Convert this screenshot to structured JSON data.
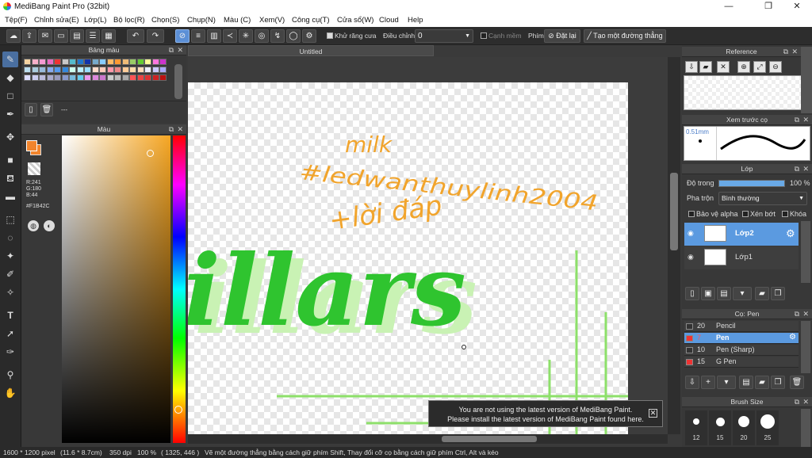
{
  "window": {
    "title": "MediBang Paint Pro (32bit)",
    "minimize": "—",
    "maximize": "❐",
    "close": "✕"
  },
  "menu": [
    "Tệp(F)",
    "Chỉnh sửa(E)",
    "Lớp(L)",
    "Bộ lọc(R)",
    "Chọn(S)",
    "Chụp(N)",
    "Màu (C)",
    "Xem(V)",
    "Công cụ(T)",
    "Cửa sổ(W)",
    "Cloud",
    "Help"
  ],
  "toolbar": {
    "anti_alias_label": "Khử răng cưa",
    "anti_alias_checked": true,
    "correction_label": "Điều chỉnh",
    "correction_value": "0",
    "smooth_edge_label": "Cạnh mềm",
    "key_label": "Phím",
    "reset_label": "Đặt lại",
    "straight_line_label": "Tạo một đường thẳng"
  },
  "palette_panel": {
    "title": "Bảng màu",
    "footer": "---"
  },
  "palette_colors": [
    "#f5d3a1",
    "#f7b0c8",
    "#f49ad2",
    "#e86cc3",
    "#e33",
    "#c8c8c8",
    "#5bc",
    "#27c",
    "#13a",
    "#7ac",
    "#8cf",
    "#fb6",
    "#f93",
    "#eb7",
    "#9c6",
    "#6c3",
    "#ff9",
    "#f7d",
    "#c3c",
    "#bde",
    "#acd",
    "#9bd",
    "#8ae",
    "#59e",
    "#38d",
    "#cfe",
    "#bef",
    "#9df",
    "#fdc",
    "#fcb",
    "#f9a",
    "#e88",
    "#fc9",
    "#fda",
    "#fdb",
    "#eef",
    "#ccf",
    "#aaf",
    "#ddf",
    "#cce",
    "#bbd",
    "#aac",
    "#99b",
    "#89c",
    "#7bd",
    "#6ce",
    "#e9e",
    "#d8d",
    "#c7c",
    "#ccc",
    "#bbb",
    "#aaa",
    "#f55",
    "#e44",
    "#d33",
    "#c22",
    "#b11"
  ],
  "color_panel": {
    "title": "Màu",
    "primary": "#F1842C",
    "r_label": "R:241",
    "g_label": "G:180",
    "b_label": "B:44",
    "hex_label": "#F1B42C"
  },
  "canvas": {
    "tab_title": "Untitled",
    "notice_line1": "You are not using the latest version of MediBang Paint.",
    "notice_line2": "Please install the latest version of MediBang Paint found here.",
    "drawn_text": [
      "milk",
      "#ledwanthuylinh2004",
      "+lời đáp",
      "illars"
    ]
  },
  "reference_panel": {
    "title": "Reference"
  },
  "brush_preview_panel": {
    "title": "Xem trước cọ",
    "size": "0.51mm"
  },
  "layers_panel": {
    "title": "Lớp",
    "opacity_label": "Độ trong",
    "opacity_value": "100 %",
    "opacity_level": 1.0,
    "blend_label": "Pha trộn",
    "blend_value": "Bình thường",
    "protect_alpha": "Bảo vệ alpha",
    "clipping": "Xén bớt",
    "lock": "Khóa",
    "layers": [
      {
        "name": "Lớp2",
        "selected": true
      },
      {
        "name": "Lớp1",
        "selected": false
      }
    ]
  },
  "brush_panel": {
    "title": "Cọ: Pen",
    "brushes": [
      {
        "size": "20",
        "name": "Pencil",
        "color": "#333",
        "selected": false
      },
      {
        "size": "7",
        "name": "Pen",
        "color": "#e33",
        "selected": true
      },
      {
        "size": "10",
        "name": "Pen (Sharp)",
        "color": "#333",
        "selected": false
      },
      {
        "size": "15",
        "name": "G Pen",
        "color": "#e33",
        "selected": false
      }
    ]
  },
  "brush_size_panel": {
    "title": "Brush Size",
    "sizes": [
      "12",
      "15",
      "20",
      "25"
    ]
  },
  "status": {
    "dimensions": "1600 * 1200 pixel",
    "physical": "(11.6 * 8.7cm)",
    "dpi": "350 dpi",
    "zoom": "100 %",
    "coords": "( 1325, 446 )",
    "hint": "Vẽ một đường thẳng bằng cách giữ phím Shift, Thay đổi cỡ cọ bằng cách giữ phím Ctrl, Alt và kéo"
  }
}
